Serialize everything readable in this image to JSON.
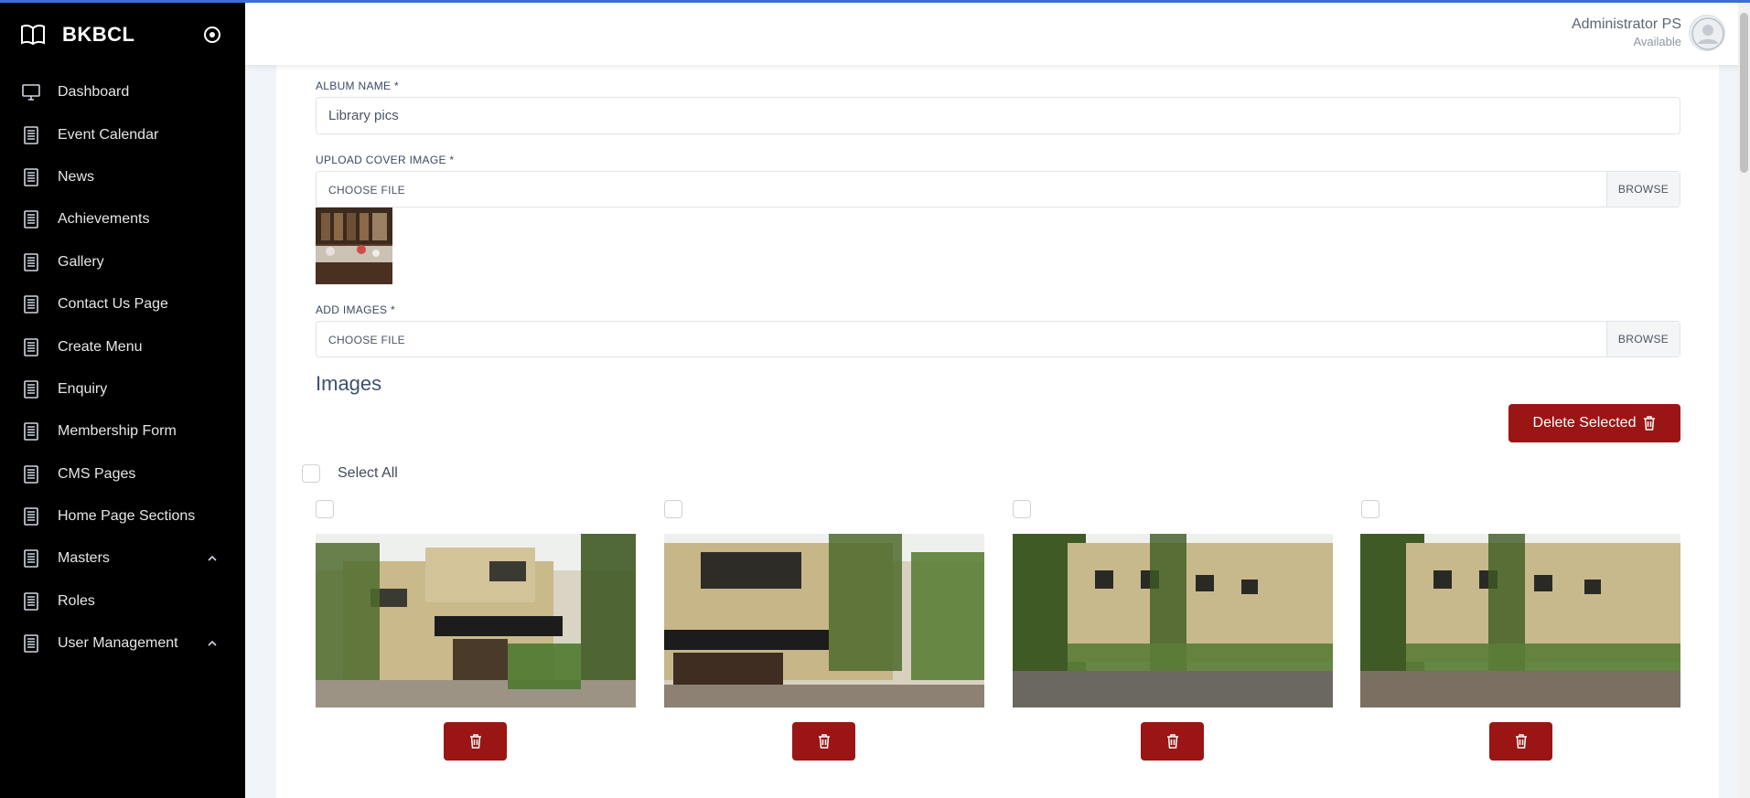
{
  "sidebar": {
    "brand": "BKBCL",
    "items": [
      {
        "label": "Dashboard"
      },
      {
        "label": "Event Calendar"
      },
      {
        "label": "News"
      },
      {
        "label": "Achievements"
      },
      {
        "label": "Gallery"
      },
      {
        "label": "Contact Us Page"
      },
      {
        "label": "Create Menu"
      },
      {
        "label": "Enquiry"
      },
      {
        "label": "Membership Form"
      },
      {
        "label": "CMS Pages"
      },
      {
        "label": "Home Page Sections"
      },
      {
        "label": "Masters"
      },
      {
        "label": "Roles"
      },
      {
        "label": "User Management"
      }
    ]
  },
  "header": {
    "user_name": "Administrator PS",
    "user_status": "Available"
  },
  "form": {
    "album_name_label": "ALBUM NAME *",
    "album_name_value": "Library pics",
    "cover_label": "UPLOAD COVER IMAGE *",
    "add_images_label": "ADD IMAGES *",
    "choose_file": "CHOOSE FILE",
    "browse": "BROWSE"
  },
  "images_section": {
    "title": "Images",
    "delete_selected": "Delete Selected",
    "select_all": "Select All"
  },
  "colors": {
    "sidebar_bg": "#000000",
    "danger": "#9b1515",
    "accent_line": "#3a6fd8"
  }
}
